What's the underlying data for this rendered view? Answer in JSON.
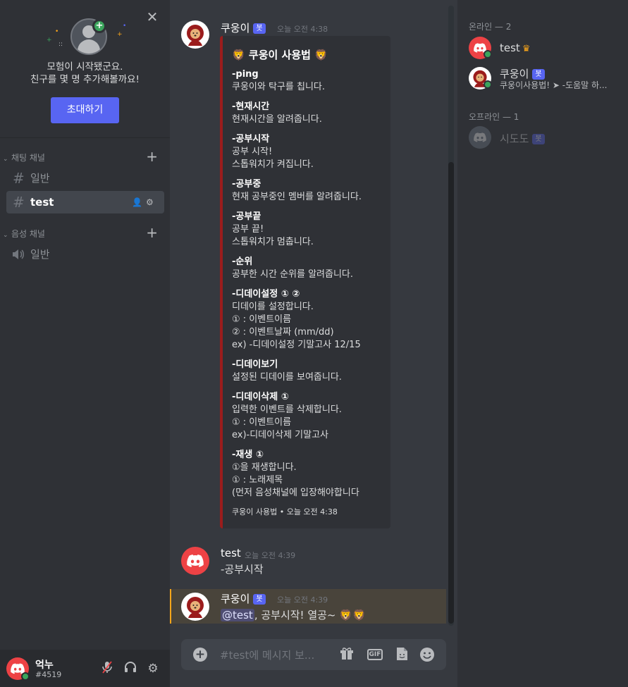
{
  "invite": {
    "close": "✕",
    "line1": "모험이 시작됐군요.",
    "line2": "친구를 몇 명 추가해볼까요!",
    "button": "초대하기"
  },
  "categories": {
    "text": "채팅 채널",
    "voice": "음성 채널"
  },
  "channels": {
    "text": [
      {
        "name": "일반"
      },
      {
        "name": "test"
      }
    ],
    "voice": [
      {
        "name": "일반"
      }
    ]
  },
  "user": {
    "name": "억누",
    "tag": "#4519"
  },
  "messages": {
    "m1": {
      "author": "쿠웅이",
      "bot": "봇",
      "time": "오늘 오전 4:38"
    },
    "embed": {
      "title": "쿠웅이 사용법",
      "fields": [
        {
          "name": "-ping",
          "value": "쿠웅이와 탁구를 칩니다."
        },
        {
          "name": "-현재시간",
          "value": "현재시간을 알려줍니다."
        },
        {
          "name": "-공부시작",
          "value": "공부 시작!\n스톱워치가 켜집니다."
        },
        {
          "name": "-공부중",
          "value": "현재 공부중인 멤버를 알려줍니다."
        },
        {
          "name": "-공부끝",
          "value": "공부 끝!\n스톱워치가 멈춥니다."
        },
        {
          "name": "-순위",
          "value": "공부한 시간 순위를 알려줍니다."
        },
        {
          "name": "-디데이설정 ① ②",
          "value": "디데이를 설정합니다.\n① : 이벤트이름\n② : 이벤트날짜 (mm/dd)\nex) -디데이설정 기말고사 12/15"
        },
        {
          "name": "-디데이보기",
          "value": "설정된 디데이를 보여줍니다."
        },
        {
          "name": "-디데이삭제 ①",
          "value": "입력한 이벤트를 삭제합니다.\n① : 이벤트이름\nex)-디데이삭제 기말고사"
        },
        {
          "name": "-재생 ①",
          "value": "①을 재생합니다.\n① : 노래제목\n(먼저 음성채널에 입장해야합니다"
        }
      ],
      "footer": "쿠웅이 사용법 • 오늘 오전 4:38"
    },
    "m2": {
      "author": "test",
      "time": "오늘 오전 4:39",
      "text": "-공부시작"
    },
    "m3": {
      "author": "쿠웅이",
      "bot": "봇",
      "time": "오늘 오전 4:39",
      "mention": "@test",
      "text": ", 공부시작! 열공~ "
    }
  },
  "composer": {
    "placeholder": "#test에 메시지 보...",
    "gif": "GIF"
  },
  "members": {
    "online_header": "온라인 — 2",
    "offline_header": "오프라인 — 1",
    "online": [
      {
        "name": "test"
      },
      {
        "name": "쿠웅이",
        "bot": "봇",
        "status": "쿠웅이사용법! ➤ -도움말 하..."
      }
    ],
    "offline": [
      {
        "name": "시도도",
        "bot": "봇"
      }
    ]
  },
  "colors": {
    "accent": "#5865f2",
    "online": "#3ba55c",
    "embed_border": "#9b1c1c",
    "highlight": "#faa61a"
  }
}
